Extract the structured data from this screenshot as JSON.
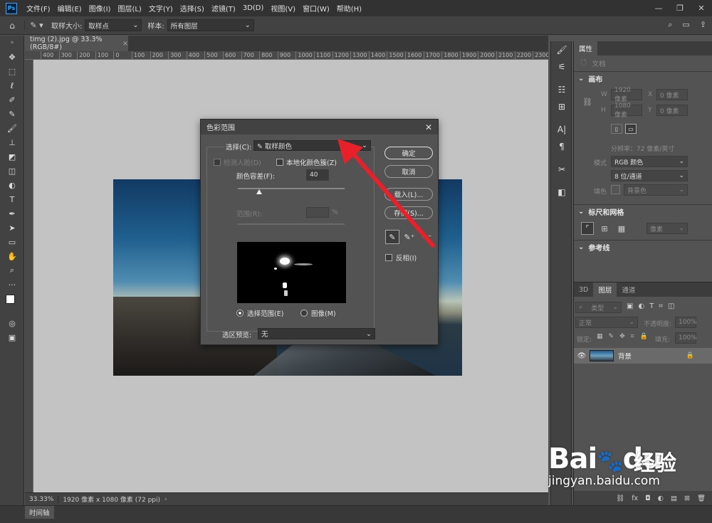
{
  "app": {
    "logo": "Ps",
    "menu": [
      "文件(F)",
      "编辑(E)",
      "图像(I)",
      "图层(L)",
      "文字(Y)",
      "选择(S)",
      "滤镜(T)",
      "3D(D)",
      "视图(V)",
      "窗口(W)",
      "帮助(H)"
    ],
    "window_controls": [
      "—",
      "❐",
      "✕"
    ]
  },
  "options_bar": {
    "sample_size_label": "取样大小:",
    "sample_size_value": "取样点",
    "sample_label": "样本:",
    "sample_value": "所有图层"
  },
  "document": {
    "tab_title": "timg (2).jpg @ 33.3%(RGB/8#)",
    "ruler_ticks": [
      "400",
      "300",
      "200",
      "100",
      "0",
      "100",
      "200",
      "300",
      "400",
      "500",
      "600",
      "700",
      "800",
      "900",
      "1000",
      "1100",
      "1200",
      "1300",
      "1400",
      "1500",
      "1600",
      "1700",
      "1800",
      "1900",
      "2000",
      "2100",
      "2200",
      "2300"
    ],
    "zoom": "33.33%",
    "size_info": "1920 像素 x 1080 像素 (72 ppi)"
  },
  "timeline_tab": "时间轴",
  "properties_panel": {
    "tab": "属性",
    "doc_label": "文档",
    "canvas_title": "画布",
    "w_label": "W",
    "w_value": "1920 像素",
    "x_label": "X",
    "x_value": "0 像素",
    "h_label": "H",
    "h_value": "1080 像素",
    "y_label": "Y",
    "y_value": "0 像素",
    "resolution": "分辨率：72 像素/英寸",
    "mode_label": "模式",
    "mode_value": "RGB 颜色",
    "bits_value": "8 位/通道",
    "fill_label": "填色",
    "fill_value": "背景色",
    "rulers_title": "标尺和网格",
    "ruler_unit": "像素",
    "guides_title": "参考线"
  },
  "layers_panel": {
    "tabs": [
      "3D",
      "图层",
      "通道"
    ],
    "filter_label": "类型",
    "blend_mode": "正常",
    "opacity_label": "不透明度:",
    "opacity_value": "100%",
    "lock_label": "锁定:",
    "fill_label": "填充:",
    "fill_value": "100%",
    "layer_name": "背景"
  },
  "dialog": {
    "title": "色彩范围",
    "select_label": "选择(C):",
    "select_value": "取样颜色",
    "detect_faces": "检测人脸(D)",
    "localized": "本地化颜色簇(Z)",
    "fuzziness_label": "颜色容差(F):",
    "fuzziness_value": "40",
    "range_label": "范围(R):",
    "range_unit": "%",
    "ok": "确定",
    "cancel": "取消",
    "load": "载入(L)...",
    "save": "存储(S)...",
    "invert": "反相(I)",
    "radio_selection": "选择范围(E)",
    "radio_image": "图像(M)",
    "preview_label": "选区预览:",
    "preview_value": "无"
  },
  "watermark": {
    "brand": "Bai",
    "brand2": "du",
    "cn": "经验",
    "url": "jingyan.baidu.com"
  },
  "colors": {
    "arrow": "#e8202a",
    "ps_blue": "#31a8ff"
  }
}
